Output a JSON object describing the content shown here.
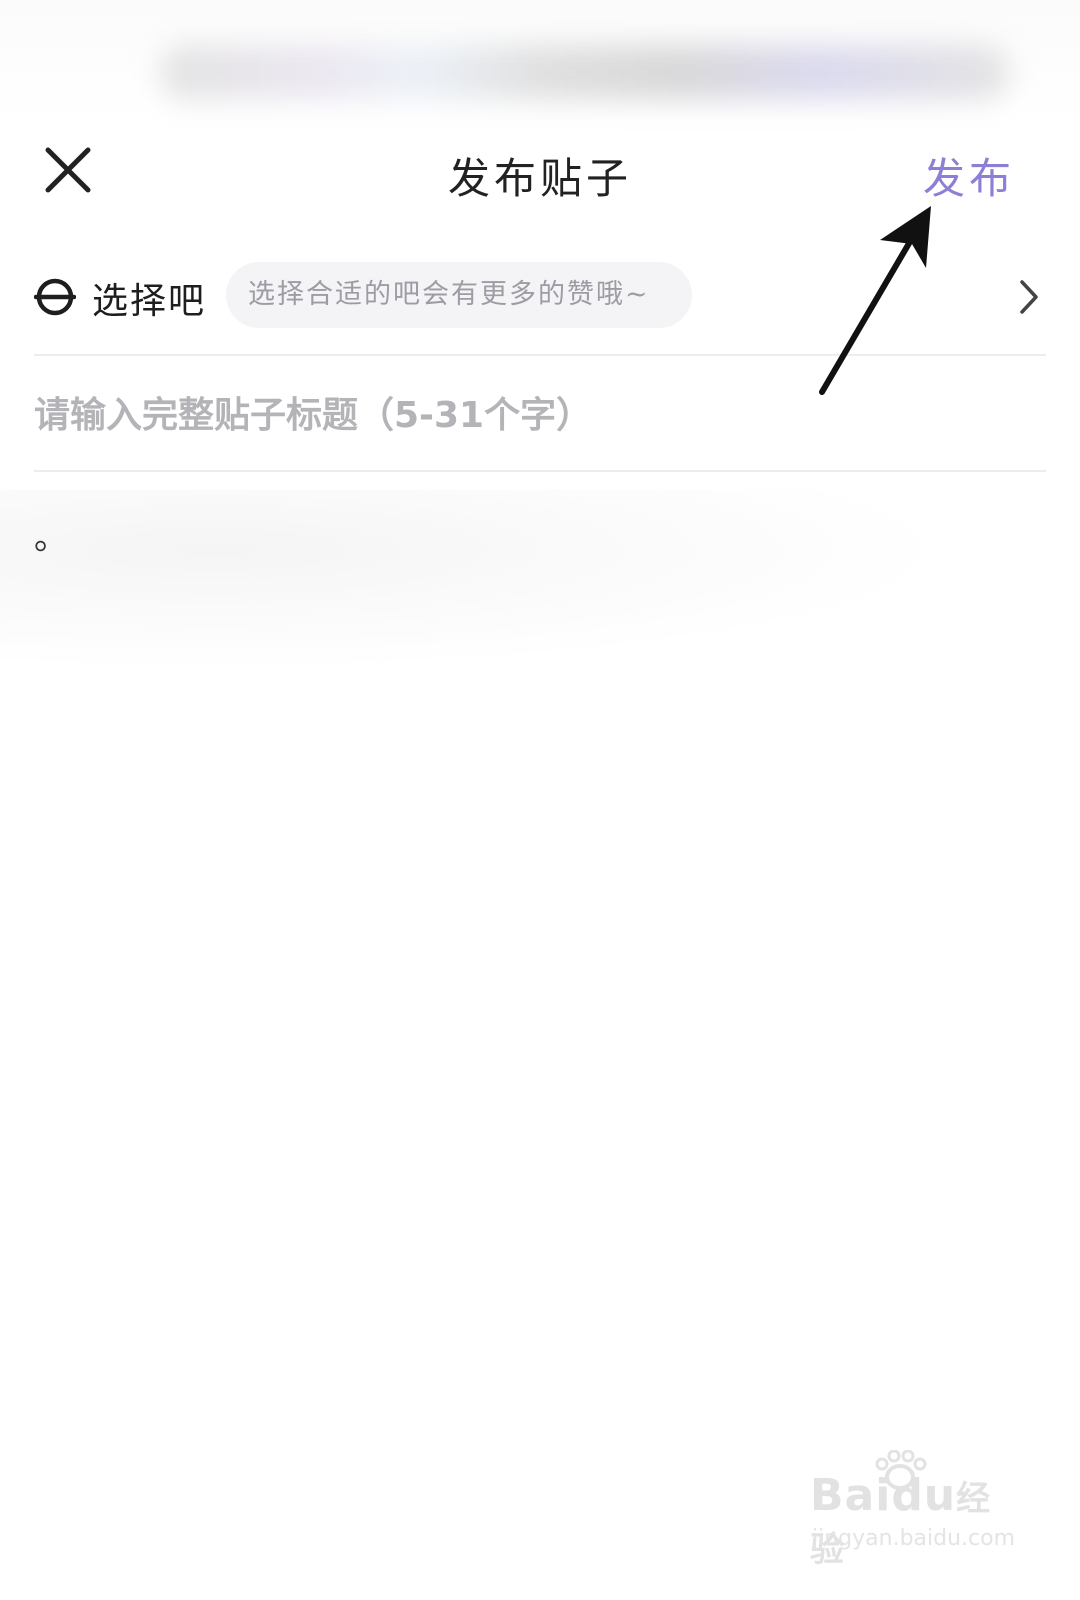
{
  "header": {
    "title": "发布贴子",
    "publish_label": "发布"
  },
  "bar_selector": {
    "label": "选择吧",
    "hint": "选择合适的吧会有更多的赞哦~"
  },
  "post_title": {
    "placeholder": "请输入完整贴子标题（5-31个字）",
    "value": ""
  },
  "post_body": {
    "text": "。"
  },
  "watermark": {
    "brand": "Bai",
    "brand_du": "du",
    "brand_cn": "经验",
    "url": "jingyan.baidu.com"
  },
  "colors": {
    "accent": "#8b7fd6",
    "text_primary": "#222222",
    "placeholder": "#b4b4b8",
    "hint_bg": "#f4f4f6"
  },
  "icons": {
    "close": "close-icon",
    "bar": "bar-circle-icon",
    "chevron": "chevron-right-icon",
    "annotation": "arrow-annotation"
  }
}
